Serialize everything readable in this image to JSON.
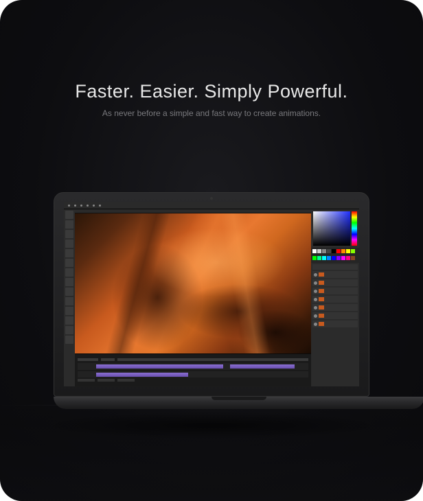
{
  "headline": "Faster. Easier. Simply Powerful.",
  "subheadline": "As never before a simple and fast way to create animations.",
  "swatch_colors": [
    "#fff",
    "#ccc",
    "#888",
    "#444",
    "#000",
    "#f00",
    "#f80",
    "#ff0",
    "#8f0",
    "#0f0",
    "#0f8",
    "#0ff",
    "#08f",
    "#00f",
    "#80f",
    "#f0f",
    "#f08",
    "#842"
  ]
}
